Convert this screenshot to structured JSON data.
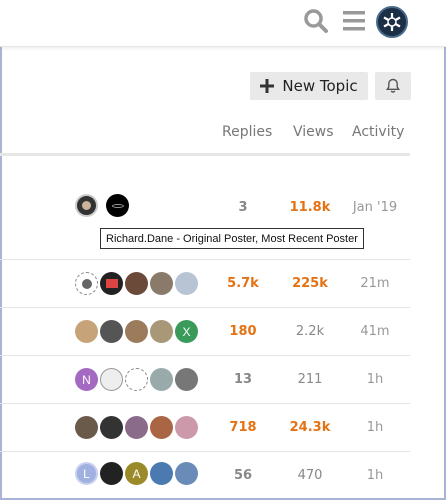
{
  "header": {
    "search_icon": "search-icon",
    "menu_icon": "hamburger-menu-icon",
    "logo_icon": "site-logo-avatar"
  },
  "actions": {
    "new_topic_label": "New Topic",
    "new_topic_icon": "plus-icon",
    "notifications_icon": "bell-icon"
  },
  "columns": {
    "replies": "Replies",
    "views": "Views",
    "activity": "Activity"
  },
  "tooltip": "Richard.Dane - Original Poster, Most Recent Poster",
  "rows": [
    {
      "replies": "3",
      "views": "11.8k",
      "activity": "Jan '19",
      "replies_color": "grey",
      "views_color": "orange"
    },
    {
      "replies": "5.7k",
      "views": "225k",
      "activity": "21m",
      "replies_color": "orange",
      "views_color": "orange"
    },
    {
      "replies": "180",
      "views": "2.2k",
      "activity": "41m",
      "replies_color": "orange",
      "views_color": "grey"
    },
    {
      "replies": "13",
      "views": "211",
      "activity": "1h",
      "replies_color": "grey",
      "views_color": "grey"
    },
    {
      "replies": "718",
      "views": "24.3k",
      "activity": "1h",
      "replies_color": "orange",
      "views_color": "orange"
    },
    {
      "replies": "56",
      "views": "470",
      "activity": "1h",
      "replies_color": "grey",
      "views_color": "grey"
    }
  ],
  "avatar_letters": {
    "x": "X",
    "n": "N",
    "a": "A",
    "l": "L"
  },
  "colors": {
    "orange": "#e47213",
    "grey": "#888888",
    "accent_border": "#aab3d6"
  }
}
